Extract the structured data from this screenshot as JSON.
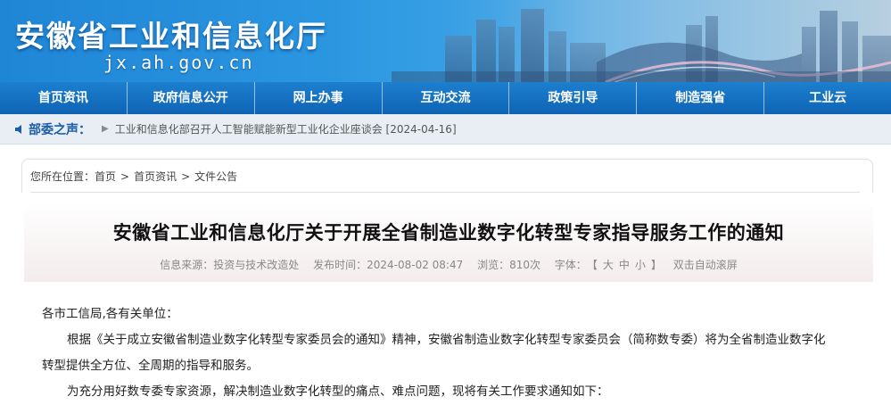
{
  "header": {
    "site_title": "安徽省工业和信息化厅",
    "site_domain": "jx.ah.gov.cn"
  },
  "nav": {
    "items": [
      {
        "label": "首页资讯"
      },
      {
        "label": "政府信息公开"
      },
      {
        "label": "网上办事"
      },
      {
        "label": "互动交流"
      },
      {
        "label": "政策引导"
      },
      {
        "label": "制造强省"
      },
      {
        "label": "工业云"
      }
    ]
  },
  "ticker": {
    "label": "部委之声：",
    "arrow": "▶",
    "text": "工业和信息化部召开人工智能赋能新型工业化企业座谈会 [2024-04-16]"
  },
  "breadcrumb": {
    "prefix": "您所在位置：",
    "items": [
      "首页",
      "首页资讯",
      "文件公告"
    ],
    "separator": ">"
  },
  "article": {
    "title": "安徽省工业和信息化厅关于开展全省制造业数字化转型专家指导服务工作的通知",
    "meta": {
      "source": "信息来源：投资与技术改造处",
      "time": "发布时间：2024-08-02 08:47",
      "views": "浏览：810次",
      "font_label": "字体：",
      "bracket_open": "【",
      "font_large": "大",
      "font_medium": "中",
      "font_small": "小",
      "bracket_close": "】",
      "scroll": "双击自动滚屏"
    },
    "paragraphs": [
      "各市工信局,各有关单位：",
      "根据《关于成立安徽省制造业数字化转型专家委员会的通知》精神，安徽省制造业数字化转型专家委员会（简称数专委）将为全省制造业数字化",
      "转型提供全方位、全周期的指导和服务。",
      "为充分用好数专委专家资源，解决制造业数字化转型的痛点、难点问题，现将有关工作要求通知如下："
    ]
  },
  "colors": {
    "nav_bg": "#0f63b4",
    "ticker_label": "#1a5da8"
  }
}
